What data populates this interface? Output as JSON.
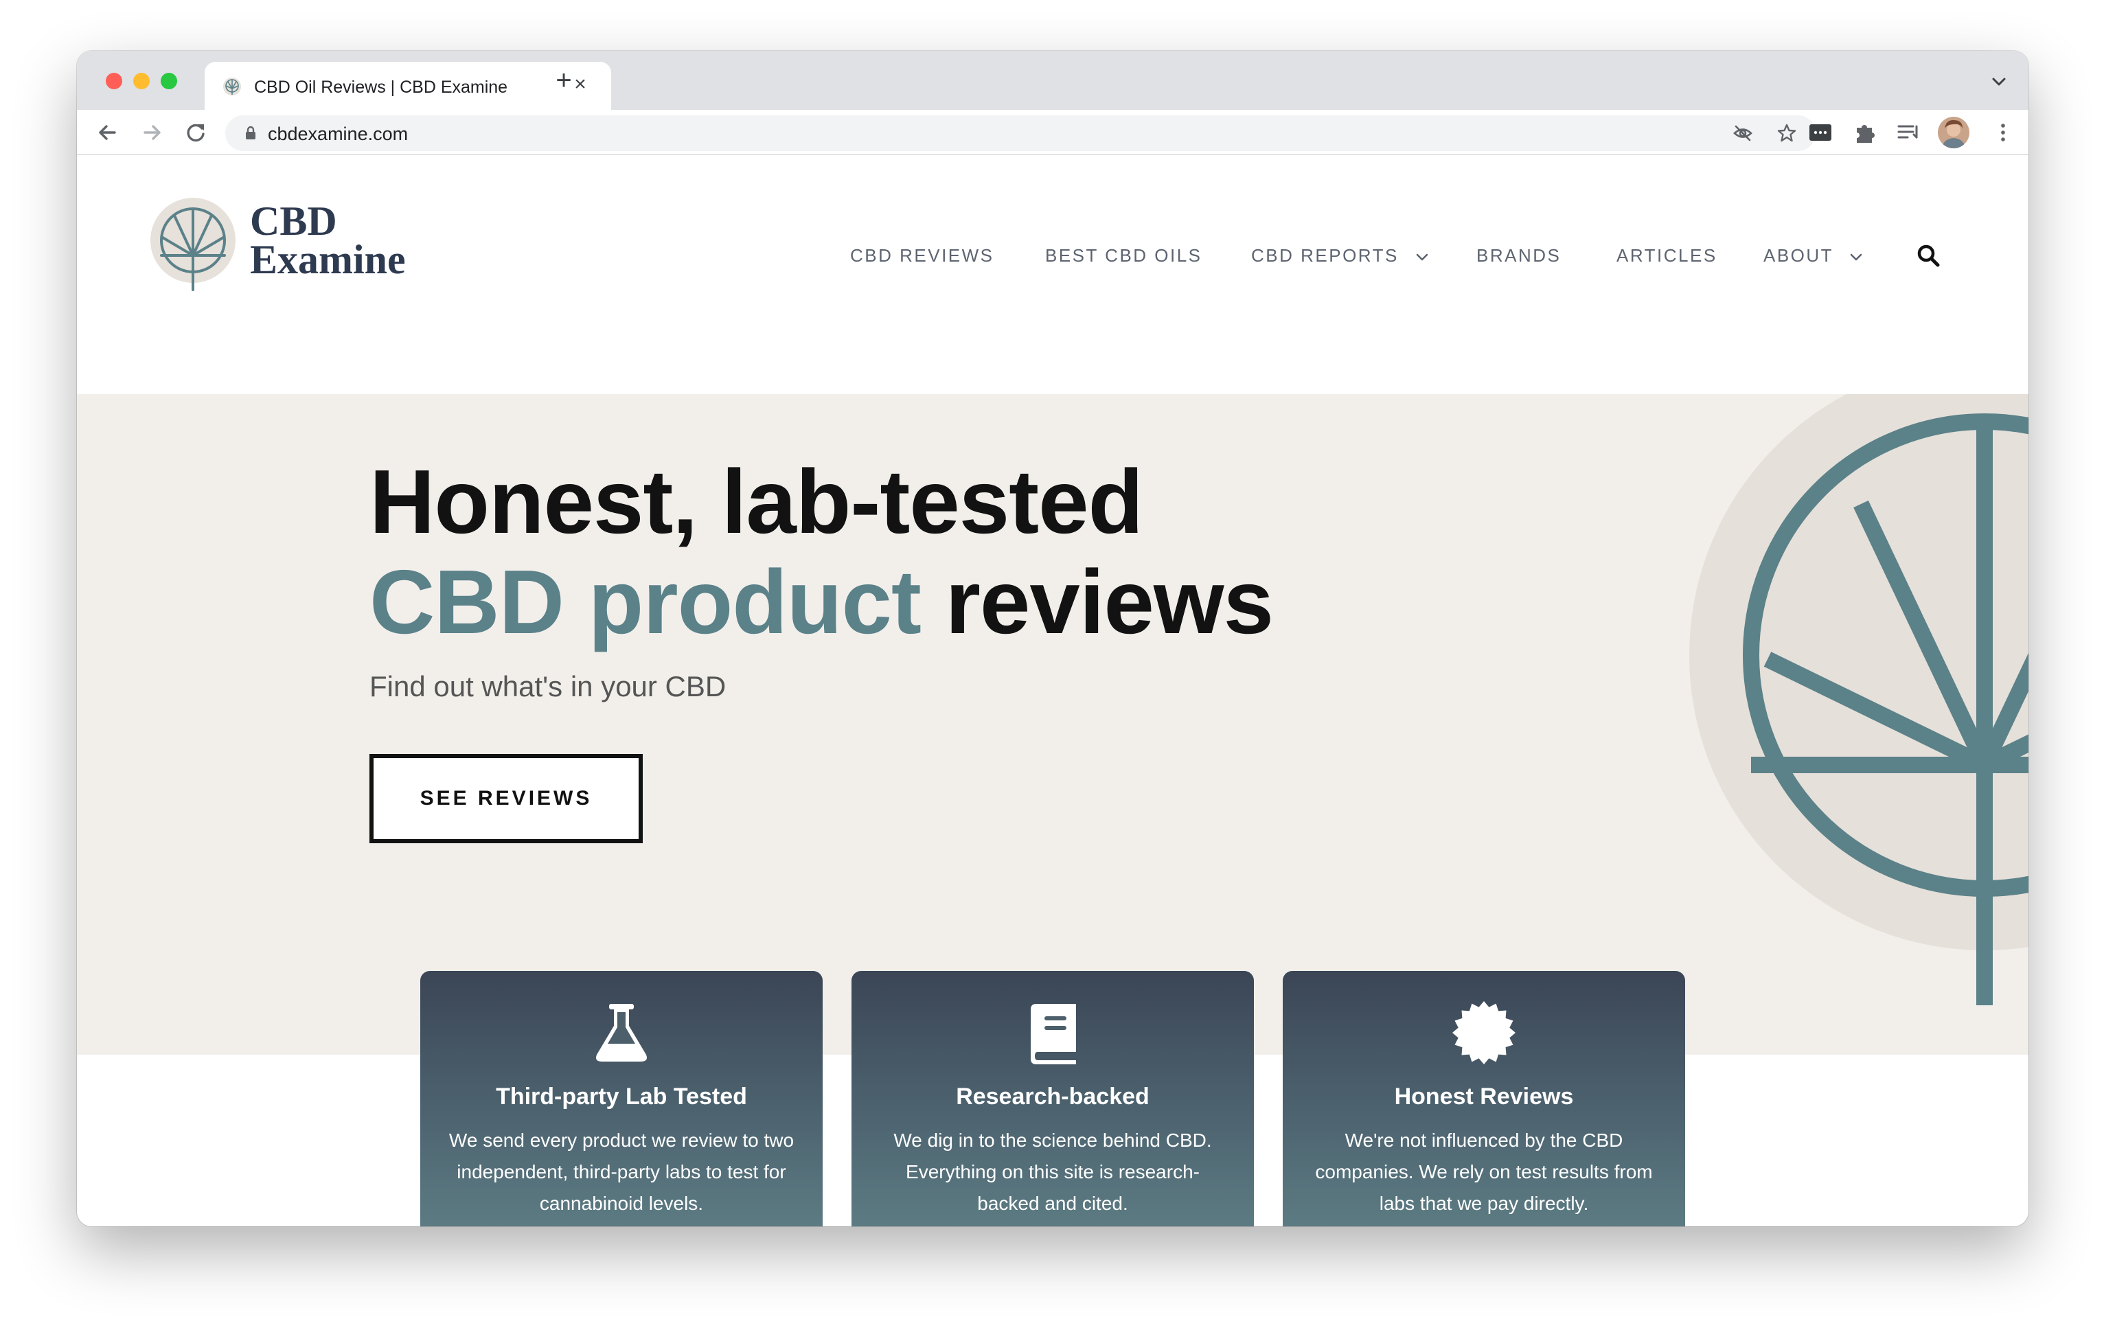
{
  "browser": {
    "tab_title": "CBD Oil Reviews | CBD Examine",
    "url": "cbdexamine.com",
    "colors": {
      "tabstrip": "#dfe1e5",
      "omnibox": "#f1f3f4"
    }
  },
  "site": {
    "logo_line1": "CBD",
    "logo_line2": "Examine",
    "nav": [
      {
        "label": "CBD REVIEWS"
      },
      {
        "label": "BEST CBD OILS"
      },
      {
        "label": "CBD REPORTS",
        "dropdown": true
      },
      {
        "label": "BRANDS"
      },
      {
        "label": "ARTICLES"
      },
      {
        "label": "ABOUT",
        "dropdown": true
      }
    ],
    "search_icon": "search-icon"
  },
  "hero": {
    "headline_line1": "Honest, lab-tested",
    "headline_accent": "CBD product",
    "headline_rest": " reviews",
    "subheading": "Find out what's in your CBD",
    "cta_label": "SEE REVIEWS",
    "colors": {
      "accent": "#5b8189",
      "background": "#f2efeb"
    }
  },
  "features": [
    {
      "icon": "flask-icon",
      "title": "Third-party Lab Tested",
      "text": "We send every product we review to two independent, third-party labs to test for cannabinoid levels."
    },
    {
      "icon": "book-icon",
      "title": "Research-backed",
      "text": "We dig in to the science behind CBD. Everything on this site is research-backed and cited."
    },
    {
      "icon": "certificate-badge-icon",
      "title": "Honest Reviews",
      "text": "We're not influenced by the CBD companies. We rely on test results from labs that we pay directly."
    }
  ]
}
